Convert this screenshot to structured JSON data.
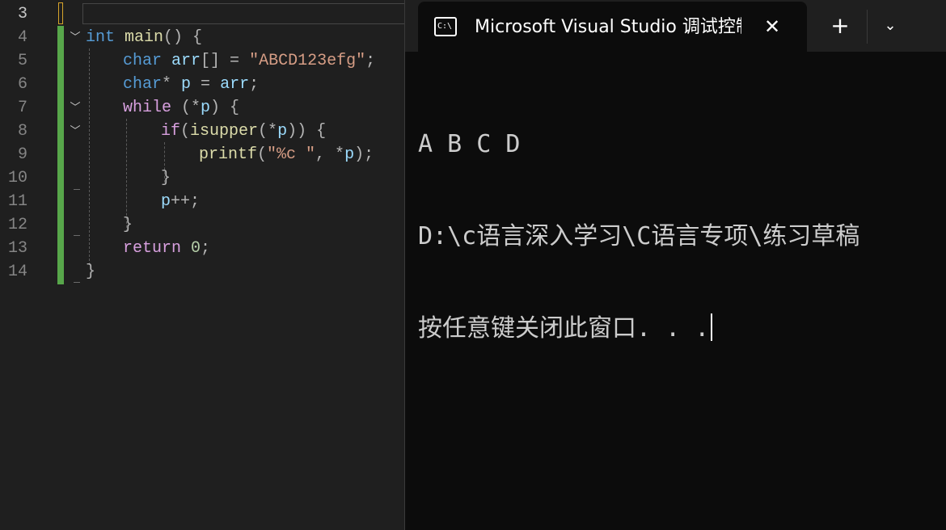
{
  "editor": {
    "lines": [
      {
        "num": "3",
        "current": true
      },
      {
        "num": "4"
      },
      {
        "num": "5"
      },
      {
        "num": "6"
      },
      {
        "num": "7"
      },
      {
        "num": "8"
      },
      {
        "num": "9"
      },
      {
        "num": "10"
      },
      {
        "num": "11"
      },
      {
        "num": "12"
      },
      {
        "num": "13"
      },
      {
        "num": "14"
      }
    ],
    "code": {
      "l4": {
        "kw": "int",
        "fn": "main",
        "rest": "() {"
      },
      "l5": {
        "kw": "char",
        "var": "arr",
        "mid": "[] = ",
        "str": "\"ABCD123efg\"",
        "end": ";"
      },
      "l6": {
        "kw": "char",
        "mid": "* ",
        "var": "p",
        "mid2": " = ",
        "var2": "arr",
        "end": ";"
      },
      "l7": {
        "kw": "while",
        "mid": " (*",
        "var": "p",
        "end": ") {"
      },
      "l8": {
        "kw": "if",
        "mid": "(",
        "fn": "isupper",
        "mid2": "(*",
        "var": "p",
        "end": ")) {"
      },
      "l9": {
        "fn": "printf",
        "mid": "(",
        "str": "\"%c \"",
        "mid2": ", *",
        "var": "p",
        "end": ");"
      },
      "l10": {
        "text": "}"
      },
      "l11": {
        "var": "p",
        "end": "++;"
      },
      "l12": {
        "text": "}"
      },
      "l13": {
        "kw": "return",
        "num": "0",
        "end": ";"
      },
      "l14": {
        "text": "}"
      }
    }
  },
  "terminal": {
    "tab_title": "Microsoft Visual Studio 调试控制台",
    "tab_icon_text": "C:\\",
    "close_icon": "close-icon",
    "new_tab_symbol": "+",
    "dropdown_symbol": "⌄",
    "output": [
      "A B C D",
      "D:\\c语言深入学习\\C语言专项\\练习草稿",
      "按任意键关闭此窗口. . ."
    ]
  },
  "colors": {
    "keyword": "#569cd6",
    "control_keyword": "#d8a0df",
    "function": "#dcdcaa",
    "variable": "#9cdcfe",
    "string": "#d69d85",
    "number": "#b5cea8",
    "change_bar": "#57a64a",
    "terminal_bg": "#0c0c0c"
  }
}
